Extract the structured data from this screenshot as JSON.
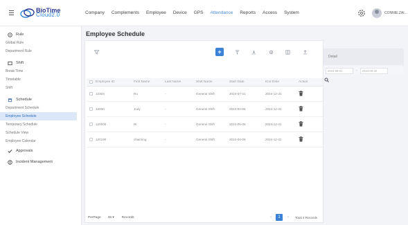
{
  "brand": {
    "line1": "BioTime",
    "line2": "Cloud2.0"
  },
  "nav": [
    "Company",
    "Complements",
    "Employee",
    "Device",
    "GPS",
    "Attendance",
    "Reports",
    "Access",
    "System"
  ],
  "nav_active_index": 5,
  "user": {
    "name": "CONNIE.ZAI..."
  },
  "sidebar": {
    "groups": [
      {
        "icon": "rule-icon",
        "label": "Rule",
        "items": [
          "Global Rule",
          "Department Rule"
        ]
      },
      {
        "icon": "shift-icon",
        "label": "Shift",
        "items": [
          "Break Time",
          "Timetable",
          "Shift"
        ]
      },
      {
        "icon": "schedule-icon",
        "label": "Schedule",
        "items": [
          "Department Schedule",
          "Employee Schedule",
          "Temporary Schedule",
          "Schedule View",
          "Employee Calendar"
        ]
      },
      {
        "icon": "approvals-icon",
        "label": "Approvals",
        "items": []
      },
      {
        "icon": "incident-icon",
        "label": "Incident Management",
        "items": []
      }
    ],
    "active_item": "Employee Schedule"
  },
  "page": {
    "title": "Employee Schedule"
  },
  "toolbar": {
    "add_label": "+"
  },
  "table": {
    "columns": [
      "Employee ID",
      "First Name",
      "Last Name",
      "Shift Name",
      "Start Date",
      "End Date",
      "Action"
    ],
    "rows": [
      {
        "employee_id": "12304",
        "first_name": "Ru",
        "last_name": "-",
        "shift_name": "General Shift",
        "start_date": "2024-07-31",
        "end_date": "2024-12-31"
      },
      {
        "employee_id": "13030",
        "first_name": "Judy",
        "last_name": "-",
        "shift_name": "General Shift",
        "start_date": "2024-04-06",
        "end_date": "2024-12-31"
      },
      {
        "employee_id": "120000",
        "first_name": "Ri",
        "last_name": "-",
        "shift_name": "General Shift",
        "start_date": "2024-05-06",
        "end_date": "2024-12-31"
      },
      {
        "employee_id": "120190",
        "first_name": "chaiming",
        "last_name": "-",
        "shift_name": "General Shift",
        "start_date": "2024-04-06",
        "end_date": "2024-12-31"
      }
    ]
  },
  "footer": {
    "per_page_label": "PerPage",
    "per_page_value": "35",
    "records_label": "Records",
    "current_page": "1",
    "total_label": "Total 4 Records"
  },
  "detail": {
    "label": "Detail",
    "date_from": "2024-09-01",
    "date_sep": "-",
    "date_to": "2024-09-30"
  },
  "colors": {
    "accent": "#3b82d6",
    "active_nav": "#4a8bd6",
    "sidebar_active_bg": "#dce8f7"
  }
}
